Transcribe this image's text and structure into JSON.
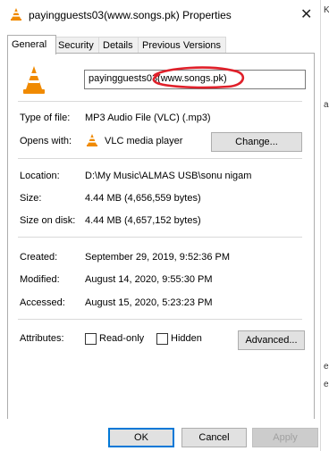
{
  "window": {
    "title": "payingguests03(www.songs.pk) Properties",
    "close_icon": "close-icon"
  },
  "tabs": [
    {
      "label": "General",
      "active": true
    },
    {
      "label": "Security",
      "active": false
    },
    {
      "label": "Details",
      "active": false
    },
    {
      "label": "Previous Versions",
      "active": false
    }
  ],
  "general": {
    "file_name": "payingguests03(www.songs.pk)",
    "type_label": "Type of file:",
    "type_value": "MP3 Audio File (VLC) (.mp3)",
    "opens_label": "Opens with:",
    "opens_value": "VLC media player",
    "change_button": "Change...",
    "location_label": "Location:",
    "location_value": "D:\\My Music\\ALMAS USB\\sonu nigam",
    "size_label": "Size:",
    "size_value": "4.44 MB (4,656,559 bytes)",
    "size_on_disk_label": "Size on disk:",
    "size_on_disk_value": "4.44 MB (4,657,152 bytes)",
    "created_label": "Created:",
    "created_value": "September 29, 2019, 9:52:36 PM",
    "modified_label": "Modified:",
    "modified_value": "August 14, 2020, 9:55:30 PM",
    "accessed_label": "Accessed:",
    "accessed_value": "August 15, 2020, 5:23:23 PM",
    "attributes_label": "Attributes:",
    "readonly_label": "Read-only",
    "readonly_checked": false,
    "hidden_label": "Hidden",
    "hidden_checked": false,
    "advanced_button": "Advanced..."
  },
  "footer": {
    "ok": "OK",
    "cancel": "Cancel",
    "apply": "Apply"
  },
  "right_strip": {
    "glyphs": [
      "K",
      "a",
      "e",
      "e"
    ]
  },
  "colors": {
    "accent": "#0078d7",
    "annotation": "#e0202a",
    "vlc_orange": "#f08a00"
  }
}
